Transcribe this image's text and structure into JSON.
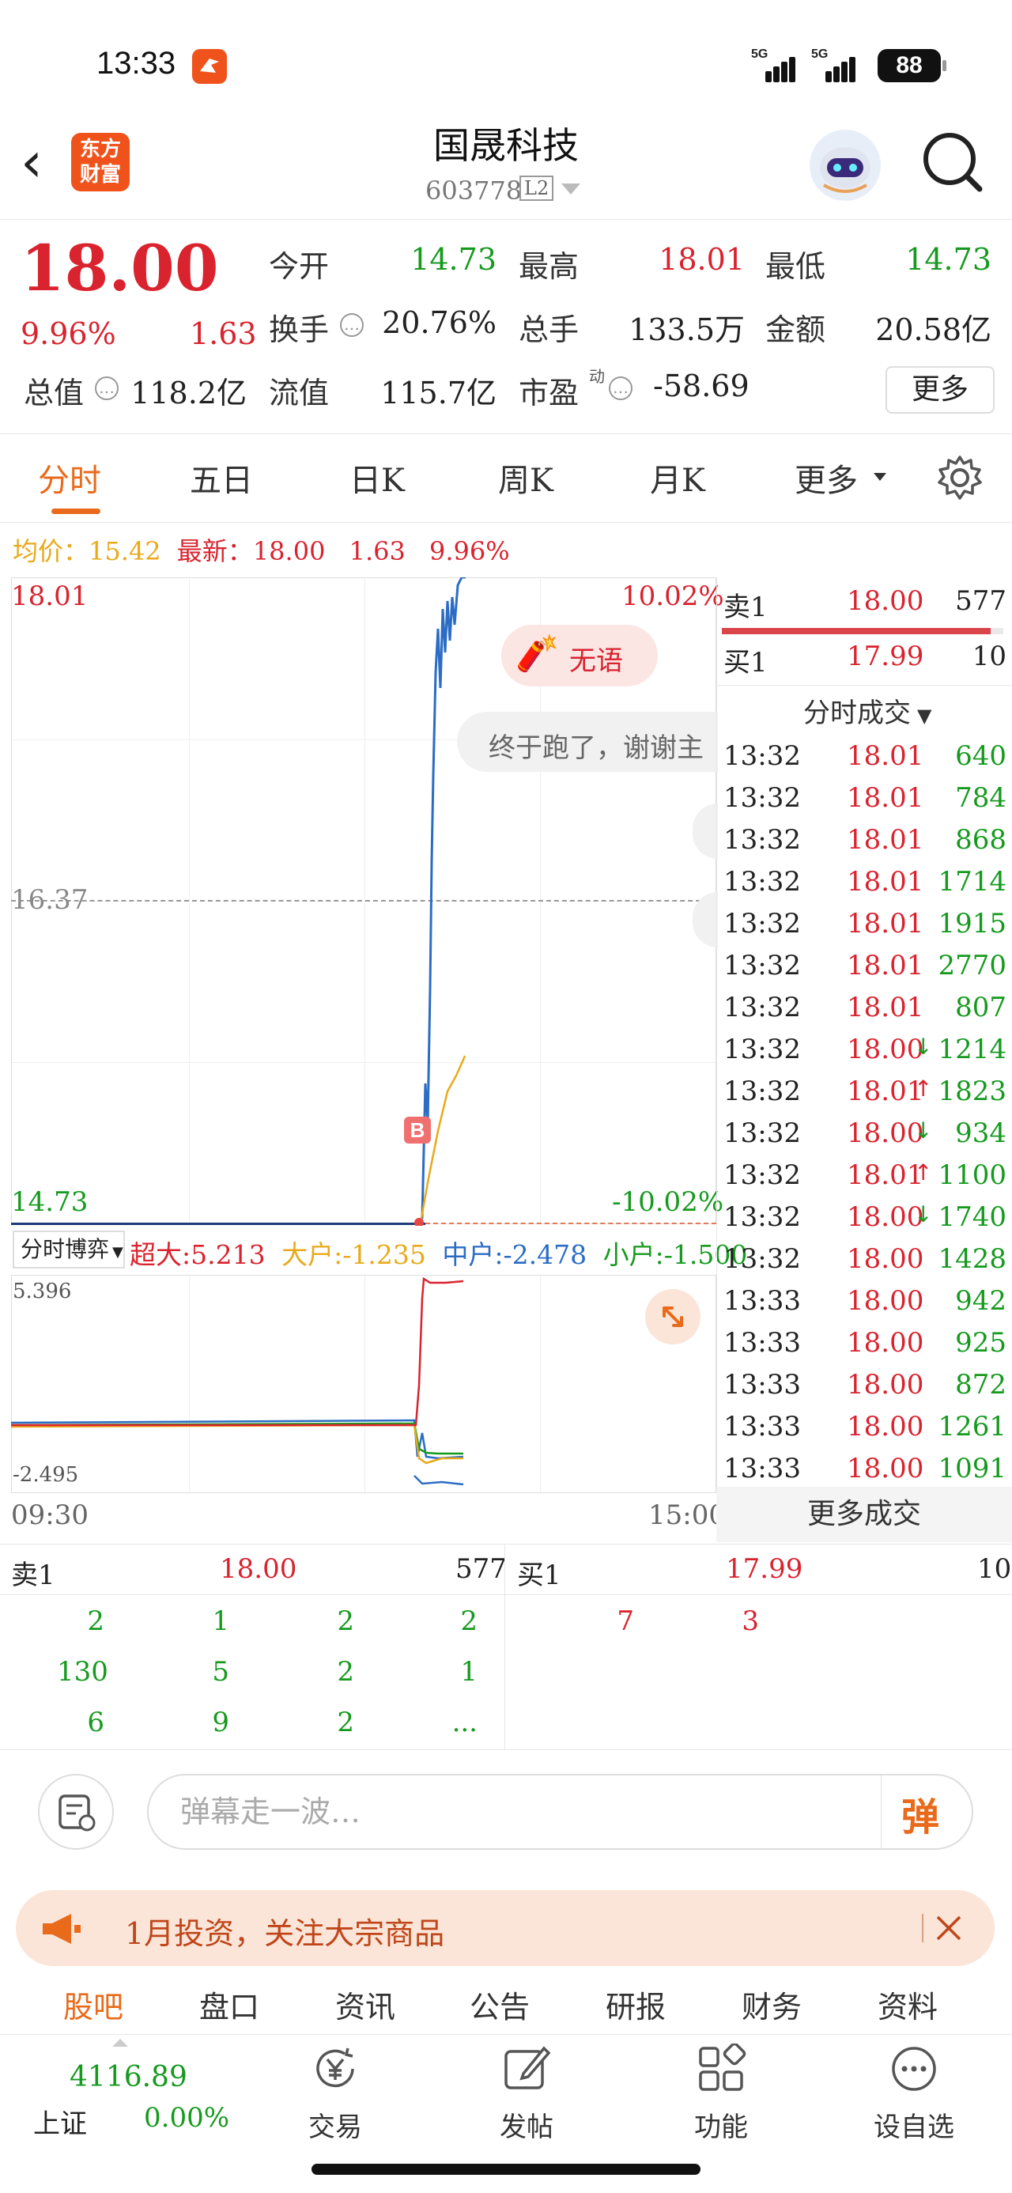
{
  "status_bar": {
    "time": "13:33",
    "signal1": "5G",
    "signal2": "5G",
    "battery": "88"
  },
  "header": {
    "logo_line1": "东方",
    "logo_line2": "财富",
    "title": "国晟科技",
    "code": "603778",
    "level": "L2"
  },
  "quote": {
    "price": "18.00",
    "change_pct": "9.96%",
    "change": "1.63",
    "rows": [
      [
        {
          "label": "今开",
          "value": "14.73",
          "color": "green"
        },
        {
          "label": "最高",
          "value": "18.01",
          "color": "red"
        },
        {
          "label": "最低",
          "value": "14.73",
          "color": "green"
        }
      ],
      [
        {
          "label": "换手",
          "value": "20.76%",
          "color": "black",
          "icon": "info-icon"
        },
        {
          "label": "总手",
          "value": "133.5万",
          "color": "black"
        },
        {
          "label": "金额",
          "value": "20.58亿",
          "color": "black"
        }
      ],
      [
        {
          "label": "总值",
          "value": "118.2亿",
          "color": "black",
          "icon": "info-icon"
        },
        {
          "label": "流值",
          "value": "115.7亿",
          "color": "black"
        },
        {
          "label": "市盈",
          "value": "-58.69",
          "color": "black",
          "icon": "info-icon",
          "sup": "动"
        }
      ]
    ],
    "more": "更多"
  },
  "tabs": [
    "分时",
    "五日",
    "日K",
    "周K",
    "月K",
    "更多"
  ],
  "chart": {
    "avg_label": "均价：",
    "avg_value": "15.42",
    "latest_label": "最新：",
    "latest_value": "18.00",
    "latest_change": "1.63",
    "latest_pct": "9.96%",
    "y_top": "18.01",
    "y_mid": "16.37",
    "y_bottom": "14.73",
    "pct_top": "10.02%",
    "pct_bottom": "-10.02%",
    "marker": "B",
    "bubble": "无语",
    "comment": "终于跑了，谢谢主",
    "sub_selector": "分时博弈",
    "sub_legend": [
      {
        "label": "超大:",
        "value": "5.213",
        "color": "#d9232e"
      },
      {
        "label": "大户:",
        "value": "-1.235",
        "color": "#e9a91a"
      },
      {
        "label": "中户:",
        "value": "-2.478",
        "color": "#2b6cc4"
      },
      {
        "label": "小户:",
        "value": "-1.500",
        "color": "#159a1e"
      }
    ],
    "sub_top": "5.396",
    "sub_bottom": "-2.495",
    "time_start": "09:30",
    "time_end": "15:00"
  },
  "orderbook": {
    "sell1_label": "卖1",
    "sell1_price": "18.00",
    "sell1_vol": "577",
    "buy1_label": "买1",
    "buy1_price": "17.99",
    "buy1_vol": "10",
    "ticks_title": "分时成交",
    "ticks": [
      {
        "time": "13:32",
        "price": "18.01",
        "vol": "640",
        "arrow": ""
      },
      {
        "time": "13:32",
        "price": "18.01",
        "vol": "784",
        "arrow": ""
      },
      {
        "time": "13:32",
        "price": "18.01",
        "vol": "868",
        "arrow": ""
      },
      {
        "time": "13:32",
        "price": "18.01",
        "vol": "1714",
        "arrow": ""
      },
      {
        "time": "13:32",
        "price": "18.01",
        "vol": "1915",
        "arrow": ""
      },
      {
        "time": "13:32",
        "price": "18.01",
        "vol": "2770",
        "arrow": ""
      },
      {
        "time": "13:32",
        "price": "18.01",
        "vol": "807",
        "arrow": ""
      },
      {
        "time": "13:32",
        "price": "18.00",
        "vol": "1214",
        "arrow": "↓"
      },
      {
        "time": "13:32",
        "price": "18.01",
        "vol": "1823",
        "arrow": "↑"
      },
      {
        "time": "13:32",
        "price": "18.00",
        "vol": "934",
        "arrow": "↓"
      },
      {
        "time": "13:32",
        "price": "18.01",
        "vol": "1100",
        "arrow": "↑"
      },
      {
        "time": "13:32",
        "price": "18.00",
        "vol": "1740",
        "arrow": "↓"
      },
      {
        "time": "13:32",
        "price": "18.00",
        "vol": "1428",
        "arrow": ""
      },
      {
        "time": "13:33",
        "price": "18.00",
        "vol": "942",
        "arrow": ""
      },
      {
        "time": "13:33",
        "price": "18.00",
        "vol": "925",
        "arrow": ""
      },
      {
        "time": "13:33",
        "price": "18.00",
        "vol": "872",
        "arrow": ""
      },
      {
        "time": "13:33",
        "price": "18.00",
        "vol": "1261",
        "arrow": ""
      },
      {
        "time": "13:33",
        "price": "18.00",
        "vol": "1091",
        "arrow": ""
      }
    ],
    "more_ticks": "更多成交"
  },
  "queue": {
    "sell_label": "卖1",
    "sell_price": "18.00",
    "sell_vol": "577",
    "buy_label": "买1",
    "buy_price": "17.99",
    "buy_vol": "10",
    "sell_rows": [
      [
        "2",
        "1",
        "2",
        "2"
      ],
      [
        "130",
        "5",
        "2",
        "1"
      ],
      [
        "6",
        "9",
        "2",
        "..."
      ]
    ],
    "buy_rows": [
      [
        "7",
        "3"
      ]
    ]
  },
  "danmu": {
    "placeholder": "弹幕走一波…",
    "send": "弹"
  },
  "promo": {
    "text": "1月投资，关注大宗商品"
  },
  "subnav": [
    "股吧",
    "盘口",
    "资讯",
    "公告",
    "研报",
    "财务",
    "资料"
  ],
  "bottom_bar": {
    "index_value": "4116.89",
    "index_name": "上证",
    "index_pct": "0.00%",
    "items": [
      {
        "label": "交易",
        "icon": "yen-icon"
      },
      {
        "label": "发帖",
        "icon": "edit-icon"
      },
      {
        "label": "功能",
        "icon": "grid-icon"
      },
      {
        "label": "设自选",
        "icon": "more-icon"
      }
    ]
  },
  "colors": {
    "up": "#d9232e",
    "down": "#159a1e",
    "accent": "#e96a1a",
    "price_line": "#2b6cc4",
    "avg_line": "#e9a91a"
  }
}
